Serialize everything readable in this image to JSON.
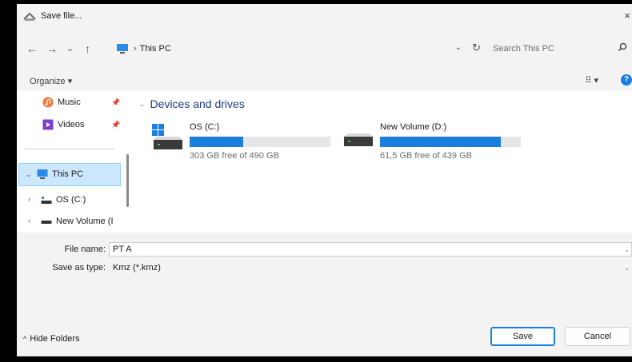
{
  "window": {
    "title": "Save file...",
    "close_glyph": "×"
  },
  "nav": {
    "back_glyph": "←",
    "forward_glyph": "→",
    "recent_glyph": "⌄",
    "up_glyph": "↑",
    "breadcrumb": [
      "This PC"
    ],
    "search_placeholder": "Search This PC"
  },
  "cmd": {
    "organize_label": "Organize ▾",
    "view_label": "⠿ ▾",
    "help_label": "?"
  },
  "sidebar": {
    "pinned": [
      {
        "label": "Music",
        "icon": "music-icon"
      },
      {
        "label": "Videos",
        "icon": "videos-icon"
      }
    ],
    "this_pc": "This PC",
    "tree": [
      {
        "label": "OS (C:)",
        "icon": "drive-icon"
      },
      {
        "label": "New Volume (I",
        "icon": "drive-icon"
      }
    ]
  },
  "content": {
    "group_label": "Devices and drives",
    "drives": [
      {
        "name": "OS (C:)",
        "free_text": "303 GB free of 490 GB",
        "used_fraction": 0.382,
        "icon": "windows-drive-icon"
      },
      {
        "name": "New Volume (D:)",
        "free_text": "61,5 GB free of 439 GB",
        "used_fraction": 0.86,
        "icon": "drive-icon"
      }
    ]
  },
  "form": {
    "file_name_label": "File name:",
    "file_name_value": "PT A",
    "save_type_label": "Save as type:",
    "save_type_value": "Kmz (*.kmz)"
  },
  "footer": {
    "hide_folders": "Hide Folders",
    "save_label": "Save",
    "cancel_label": "Cancel"
  },
  "colors": {
    "accent": "#1a7de0",
    "selection": "#cce8ff",
    "chrome": "#f3f3f3"
  }
}
